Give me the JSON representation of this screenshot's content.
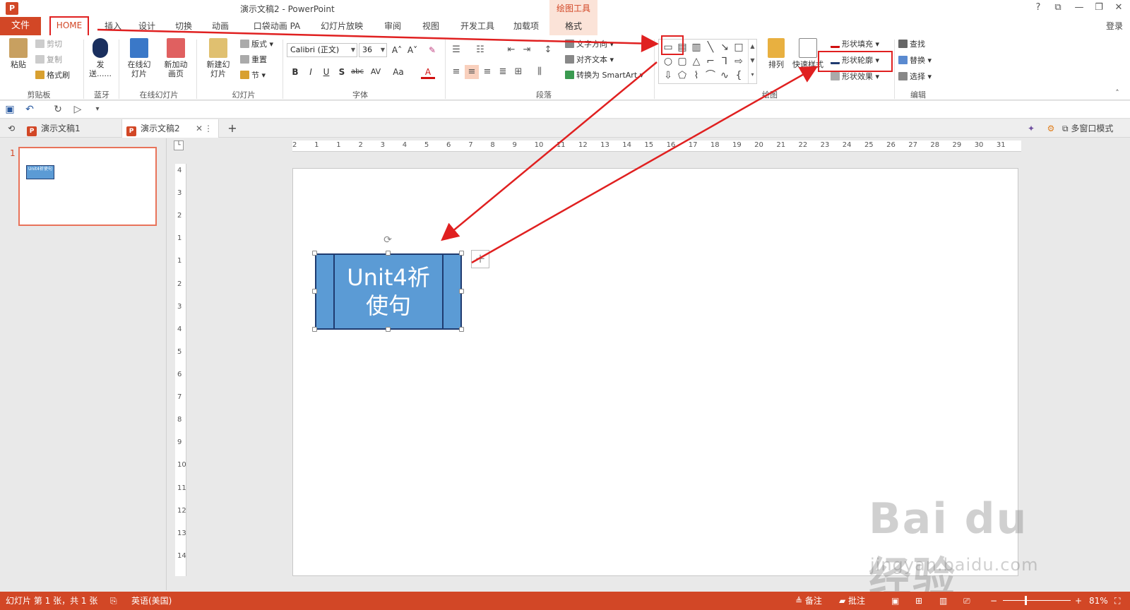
{
  "window": {
    "title": "演示文稿2 - PowerPoint",
    "app_icon": "P",
    "context_tab_group": "绘图工具",
    "controls": [
      "?",
      "⧉",
      "—",
      "❐",
      "✕"
    ],
    "login": "登录"
  },
  "tabs": {
    "file": "文件",
    "items": [
      "HOME",
      "插入",
      "设计",
      "切换",
      "动画",
      "口袋动画 PA",
      "幻灯片放映",
      "审阅",
      "视图",
      "开发工具",
      "加载项",
      "格式"
    ]
  },
  "ribbon": {
    "clipboard": {
      "paste": "粘贴",
      "cut": "剪切",
      "copy": "复制",
      "format_painter": "格式刷",
      "label": "剪贴板"
    },
    "bluetooth": {
      "send": "发送......",
      "label": "蓝牙"
    },
    "online": {
      "online_slides": "在线幻灯片",
      "new_anim_page": "新加动画页",
      "label": "在线幻灯片"
    },
    "slides": {
      "new_slide": "新建幻灯片",
      "layout": "版式",
      "reset": "重置",
      "section": "节",
      "label": "幻灯片"
    },
    "font": {
      "name": "Calibri (正文)",
      "size": "36",
      "grow": "A˄",
      "shrink": "A˅",
      "clear": "✎",
      "bold": "B",
      "italic": "I",
      "underline": "U",
      "shadow": "S",
      "strike": "abc",
      "spacing": "AV",
      "case": "Aa",
      "color": "A",
      "label": "字体"
    },
    "paragraph": {
      "text_direction": "文字方向",
      "align_text": "对齐文本",
      "smartart": "转换为 SmartArt",
      "label": "段落"
    },
    "drawing": {
      "arrange": "排列",
      "quick_styles": "快速样式",
      "shape_fill": "形状填充",
      "shape_outline": "形状轮廓",
      "shape_effects": "形状效果",
      "label": "绘图"
    },
    "editing": {
      "find": "查找",
      "replace": "替换",
      "select": "选择",
      "label": "编辑"
    }
  },
  "doc_tabs": [
    "演示文稿1",
    "演示文稿2"
  ],
  "multi_window": "多窗口模式",
  "thumbnail": {
    "number": "1",
    "text": "Unit4祈使句"
  },
  "ruler": {
    "h": [
      "2",
      "1",
      "1",
      "2",
      "3",
      "4",
      "5",
      "6",
      "7",
      "8",
      "9",
      "10",
      "11",
      "12",
      "13",
      "14",
      "15",
      "16",
      "17",
      "18",
      "19",
      "20",
      "21",
      "22",
      "23",
      "24",
      "25",
      "26",
      "27",
      "28",
      "29",
      "30",
      "31"
    ],
    "v": [
      "4",
      "3",
      "2",
      "1",
      "1",
      "2",
      "3",
      "4",
      "5",
      "6",
      "7",
      "8",
      "9",
      "10",
      "11",
      "12",
      "13",
      "14"
    ]
  },
  "slide": {
    "shape_text_line1": "Unit4祈",
    "shape_text_line2": "使句"
  },
  "status": {
    "slide_info": "幻灯片 第 1 张，共 1 张",
    "language": "英语(美国)",
    "notes": "备注",
    "comments": "批注",
    "zoom": "81%"
  },
  "watermark": {
    "brand": "Bai du 经验",
    "url": "jingyan.baidu.com"
  },
  "colors": {
    "accent": "#d24726",
    "shape_fill": "#5b9bd5",
    "shape_border": "#1f3b70",
    "annotation": "#e02020"
  }
}
